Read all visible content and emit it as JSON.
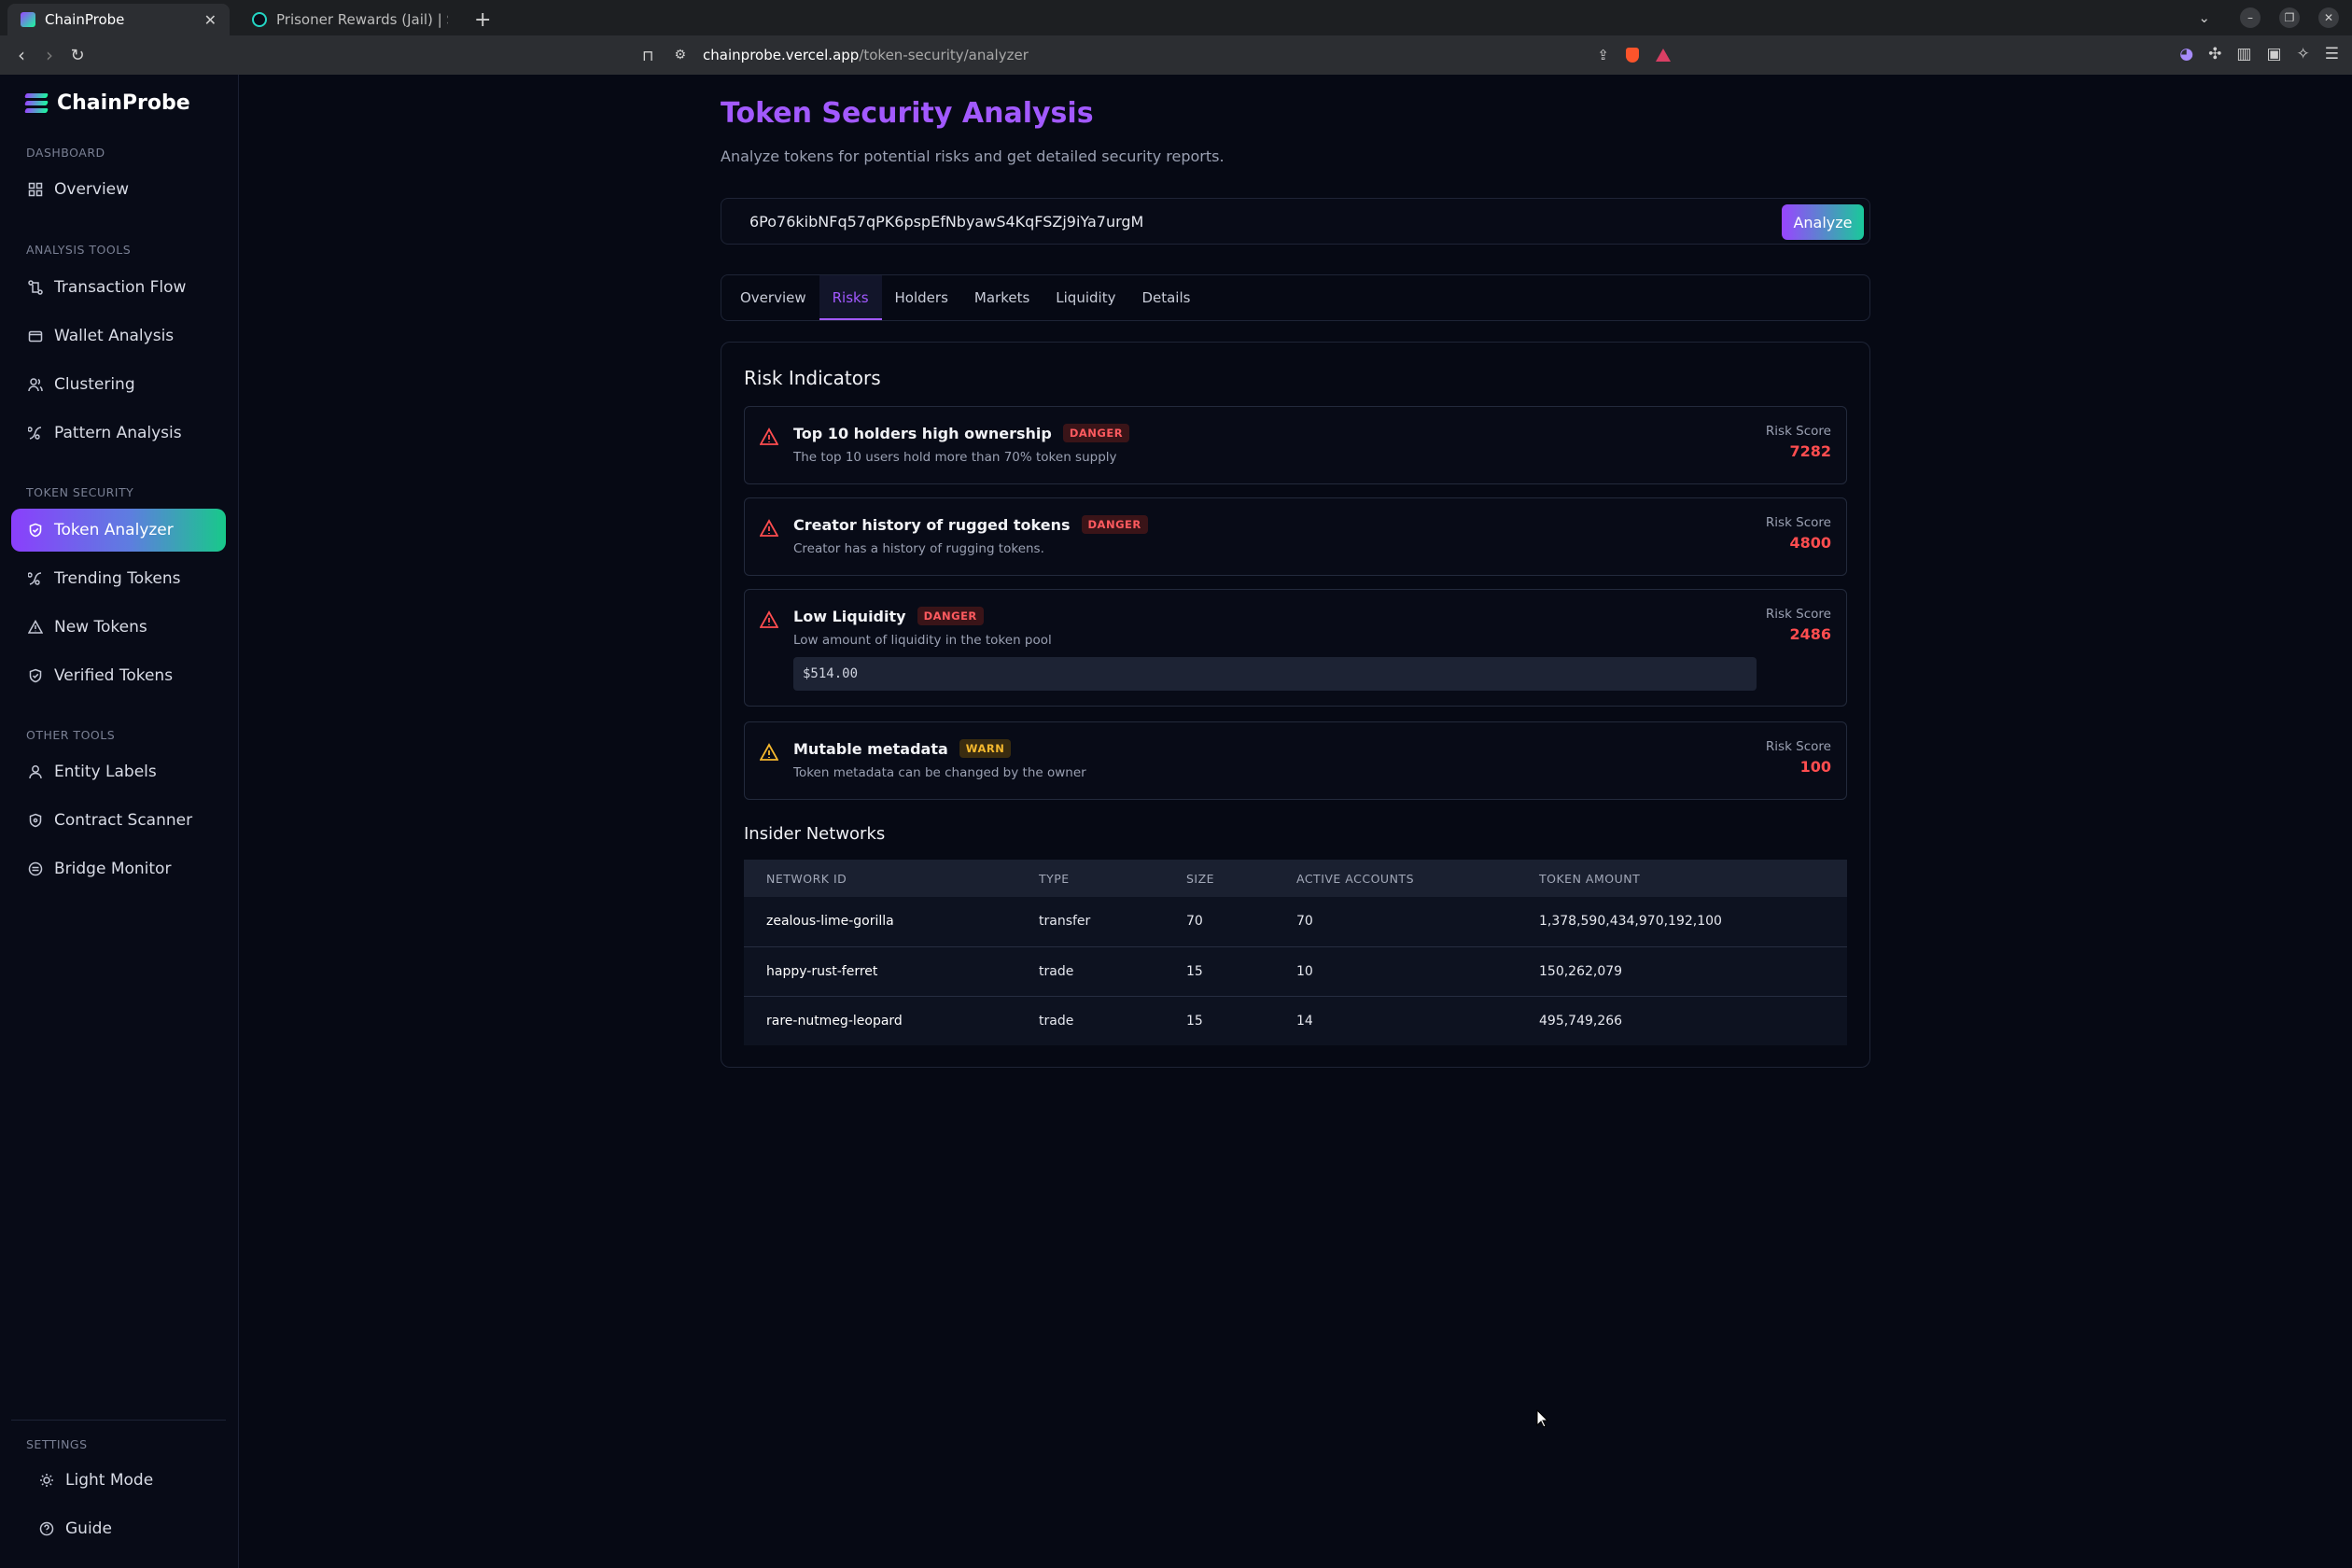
{
  "browser": {
    "tabs": [
      {
        "title": "ChainProbe",
        "active": true
      },
      {
        "title": "Prisoner Rewards (Jail) | Sol",
        "active": false
      }
    ],
    "new_tab_label": "+",
    "url_host": "chainprobe.vercel.app",
    "url_path": "/token-security/analyzer"
  },
  "app": {
    "name": "ChainProbe"
  },
  "sidebar": {
    "sections": {
      "dashboard": "DASHBOARD",
      "analysis": "ANALYSIS TOOLS",
      "token_security": "TOKEN SECURITY",
      "other": "OTHER TOOLS",
      "settings": "SETTINGS"
    },
    "items": {
      "overview": "Overview",
      "transaction_flow": "Transaction Flow",
      "wallet_analysis": "Wallet Analysis",
      "clustering": "Clustering",
      "pattern_analysis": "Pattern Analysis",
      "token_analyzer": "Token Analyzer",
      "trending_tokens": "Trending Tokens",
      "new_tokens": "New Tokens",
      "verified_tokens": "Verified Tokens",
      "entity_labels": "Entity Labels",
      "contract_scanner": "Contract Scanner",
      "bridge_monitor": "Bridge Monitor",
      "light_mode": "Light Mode",
      "guide": "Guide"
    }
  },
  "main": {
    "title": "Token Security Analysis",
    "subtitle": "Analyze tokens for potential risks and get detailed security reports.",
    "search_value": "6Po76kibNFq57qPK6pspEfNbyawS4KqFSZj9iYa7urgM",
    "analyze_label": "Analyze",
    "tabs": [
      "Overview",
      "Risks",
      "Holders",
      "Markets",
      "Liquidity",
      "Details"
    ],
    "active_tab": "Risks"
  },
  "risks": {
    "title": "Risk Indicators",
    "score_label": "Risk Score",
    "items": [
      {
        "name": "Top 10 holders high ownership",
        "level": "DANGER",
        "description": "The top 10 users hold more than 70% token supply",
        "score": "7282"
      },
      {
        "name": "Creator history of rugged tokens",
        "level": "DANGER",
        "description": "Creator has a history of rugging tokens.",
        "score": "4800"
      },
      {
        "name": "Low Liquidity",
        "level": "DANGER",
        "description": "Low amount of liquidity in the token pool",
        "score": "2486",
        "value": "$514.00"
      },
      {
        "name": "Mutable metadata",
        "level": "WARN",
        "description": "Token metadata can be changed by the owner",
        "score": "100"
      }
    ]
  },
  "insider": {
    "title": "Insider Networks",
    "columns": [
      "NETWORK ID",
      "TYPE",
      "SIZE",
      "ACTIVE ACCOUNTS",
      "TOKEN AMOUNT"
    ],
    "rows": [
      [
        "zealous-lime-gorilla",
        "transfer",
        "70",
        "70",
        "1,378,590,434,970,192,100"
      ],
      [
        "happy-rust-ferret",
        "trade",
        "15",
        "10",
        "150,262,079"
      ],
      [
        "rare-nutmeg-leopard",
        "trade",
        "15",
        "14",
        "495,749,266"
      ]
    ]
  },
  "colors": {
    "accent": "#a259ff",
    "danger": "#ff4d4f",
    "warn": "#f5b82e",
    "gradient_start": "#9945ff",
    "gradient_end": "#19fb9b"
  }
}
